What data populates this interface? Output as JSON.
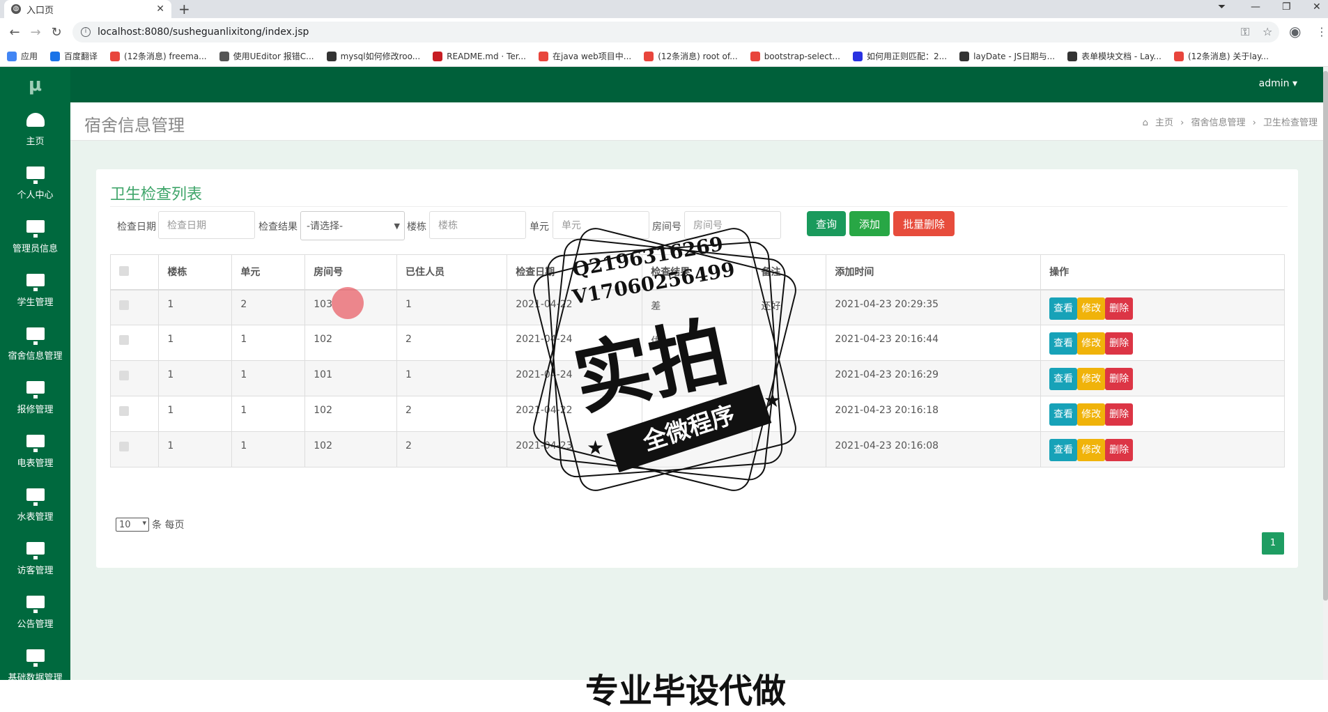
{
  "browser": {
    "tab_title": "入口页",
    "url": "localhost:8080/susheguanlixitong/index.jsp",
    "bookmarks": [
      "应用",
      "百度翻译",
      "(12条消息) freema...",
      "使用UEditor 报错C...",
      "mysql如何修改roo...",
      "README.md · Ter...",
      "在java web项目中...",
      "(12条消息) root of...",
      "bootstrap-select...",
      "如何用正则匹配：2...",
      "layDate - JS日期与...",
      "表单模块文档 - Lay...",
      "(12条消息) 关于lay..."
    ]
  },
  "sidebar": {
    "logo": "μ",
    "items": [
      "主页",
      "个人中心",
      "管理员信息",
      "学生管理",
      "宿舍信息管理",
      "报修管理",
      "电表管理",
      "水表管理",
      "访客管理",
      "公告管理",
      "基础数据管理"
    ]
  },
  "topbar": {
    "user": "admin ▾"
  },
  "header": {
    "title": "宿舍信息管理",
    "breadcrumb": [
      "主页",
      "宿舍信息管理",
      "卫生检查管理"
    ]
  },
  "card": {
    "title": "卫生检查列表"
  },
  "filters": {
    "date_label": "检查日期",
    "date_placeholder": "检查日期",
    "result_label": "检查结果",
    "result_value": "-请选择-",
    "building_label": "楼栋",
    "building_placeholder": "楼栋",
    "unit_label": "单元",
    "unit_placeholder": "单元",
    "room_label": "房间号",
    "room_placeholder": "房间号",
    "query": "查询",
    "add": "添加",
    "batch_delete": "批量删除"
  },
  "table": {
    "headers": [
      "楼栋",
      "单元",
      "房间号",
      "已住人员",
      "检查日期",
      "检查结果",
      "备注",
      "添加时间",
      "操作"
    ],
    "rows": [
      [
        "1",
        "2",
        "103",
        "1",
        "2021-04-22",
        "差",
        "还好",
        "2021-04-23 20:29:35"
      ],
      [
        "1",
        "1",
        "102",
        "2",
        "2021-04-24",
        "优",
        "",
        "2021-04-23 20:16:44"
      ],
      [
        "1",
        "1",
        "101",
        "1",
        "2021-04-24",
        "",
        "",
        "2021-04-23 20:16:29"
      ],
      [
        "1",
        "1",
        "102",
        "2",
        "2021-04-22",
        "",
        "",
        "2021-04-23 20:16:18"
      ],
      [
        "1",
        "1",
        "102",
        "2",
        "2021-04-23",
        "差",
        "",
        "2021-04-23 20:16:08"
      ]
    ],
    "actions": {
      "view": "查看",
      "edit": "修改",
      "delete": "删除"
    }
  },
  "pager": {
    "page_size": "10",
    "per_page_label": "条 每页",
    "current_page": "1"
  },
  "watermark": {
    "line1": "Q2196316269",
    "line2": "V17060256499",
    "main": "实拍",
    "banner": "全微程序",
    "bottom": "专业毕设代做"
  },
  "colors": {
    "sidebar": "#00693e",
    "topbar": "#00603a",
    "accent": "#3fa56a",
    "view": "#17a2b8",
    "edit": "#f0b30a",
    "delete": "#dc3545"
  }
}
